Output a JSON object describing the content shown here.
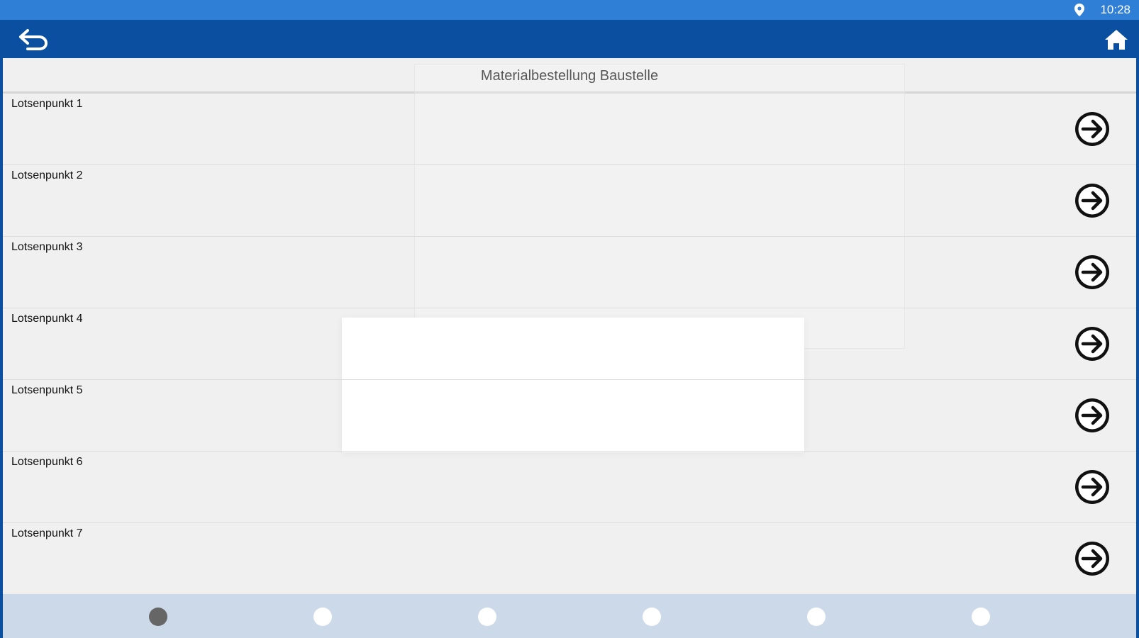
{
  "status_bar": {
    "time": "10:28",
    "location_icon": "location-pin-icon"
  },
  "app_bar": {
    "back_icon": "back-arrow-icon",
    "home_icon": "home-icon",
    "color": "#0a4fa0"
  },
  "page": {
    "title": "Materialbestellung Baustelle"
  },
  "list": {
    "items": [
      {
        "label": "Lotsenpunkt 1",
        "icon": "arrow-right-circle-icon"
      },
      {
        "label": "Lotsenpunkt 2",
        "icon": "arrow-right-circle-icon"
      },
      {
        "label": "Lotsenpunkt 3",
        "icon": "arrow-right-circle-icon"
      },
      {
        "label": "Lotsenpunkt 4",
        "icon": "arrow-right-circle-icon"
      },
      {
        "label": "Lotsenpunkt 5",
        "icon": "arrow-right-circle-icon"
      },
      {
        "label": "Lotsenpunkt 6",
        "icon": "arrow-right-circle-icon"
      },
      {
        "label": "Lotsenpunkt 7",
        "icon": "arrow-right-circle-icon"
      }
    ]
  },
  "pager": {
    "count": 6,
    "active_index": 0
  },
  "colors": {
    "status_bar": "#2f7fd6",
    "app_bar": "#0a4fa0",
    "pager_bg": "#ccd9e8",
    "dot_active": "#666666",
    "dot_inactive": "#ffffff"
  }
}
